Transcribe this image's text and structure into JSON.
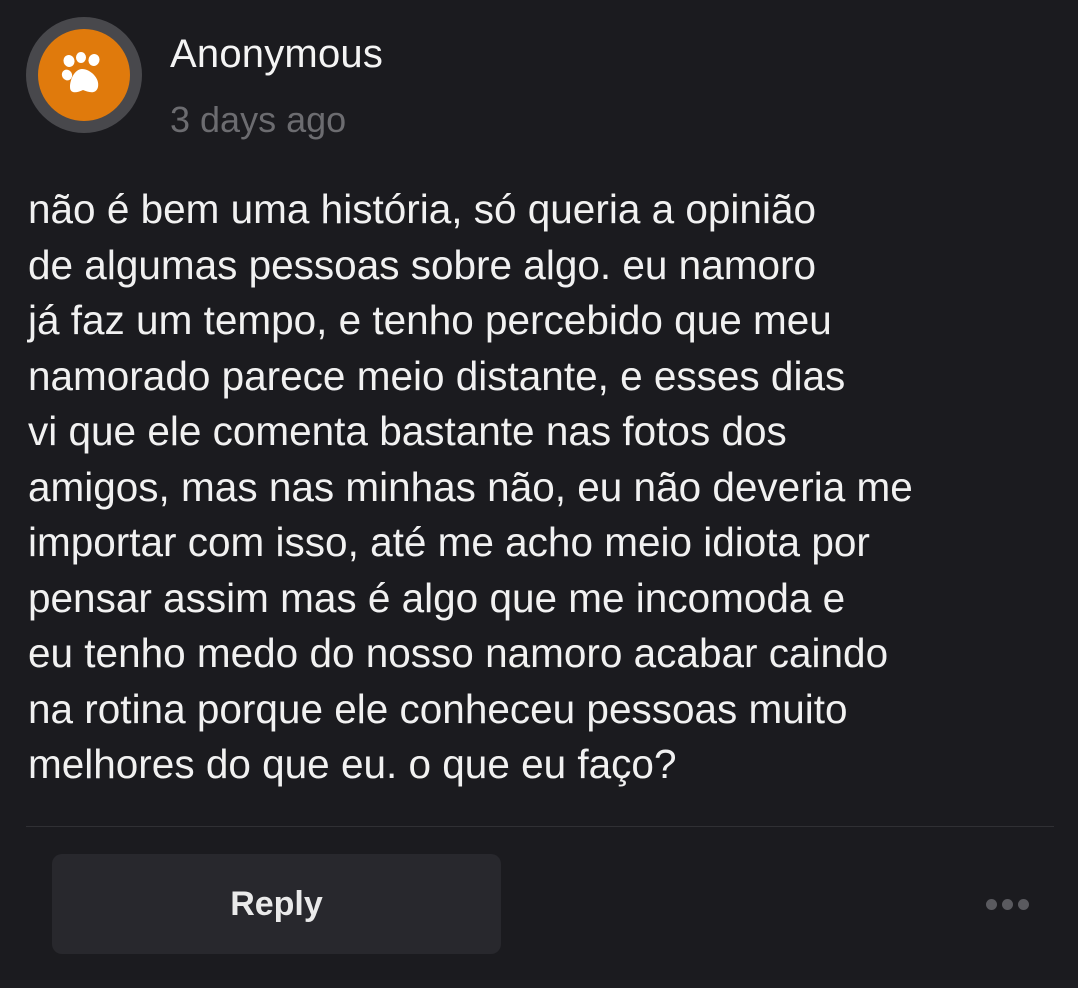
{
  "post": {
    "author": "Anonymous",
    "timestamp": "3 days ago",
    "avatar_icon": "paw-icon",
    "body_lines": [
      "não é bem uma história, só queria a opinião",
      "de algumas pessoas sobre algo. eu namoro",
      "já faz um tempo, e tenho percebido que meu",
      "namorado parece meio distante, e esses dias",
      "vi que ele comenta bastante nas fotos dos",
      "amigos, mas nas minhas não, eu não deveria me",
      "importar com isso, até me acho meio idiota por",
      "pensar assim mas é algo que me incomoda e",
      "eu tenho medo do nosso namoro acabar caindo",
      "na rotina porque ele conheceu pessoas muito",
      "melhores do que eu. o que eu faço?"
    ]
  },
  "actions": {
    "reply_label": "Reply",
    "more_icon": "more-dots-icon"
  },
  "colors": {
    "background": "#1b1b1f",
    "avatar": "#e07a0c",
    "avatar_ring": "#48484c",
    "button": "#28282d",
    "muted_text": "#6c6c70"
  }
}
